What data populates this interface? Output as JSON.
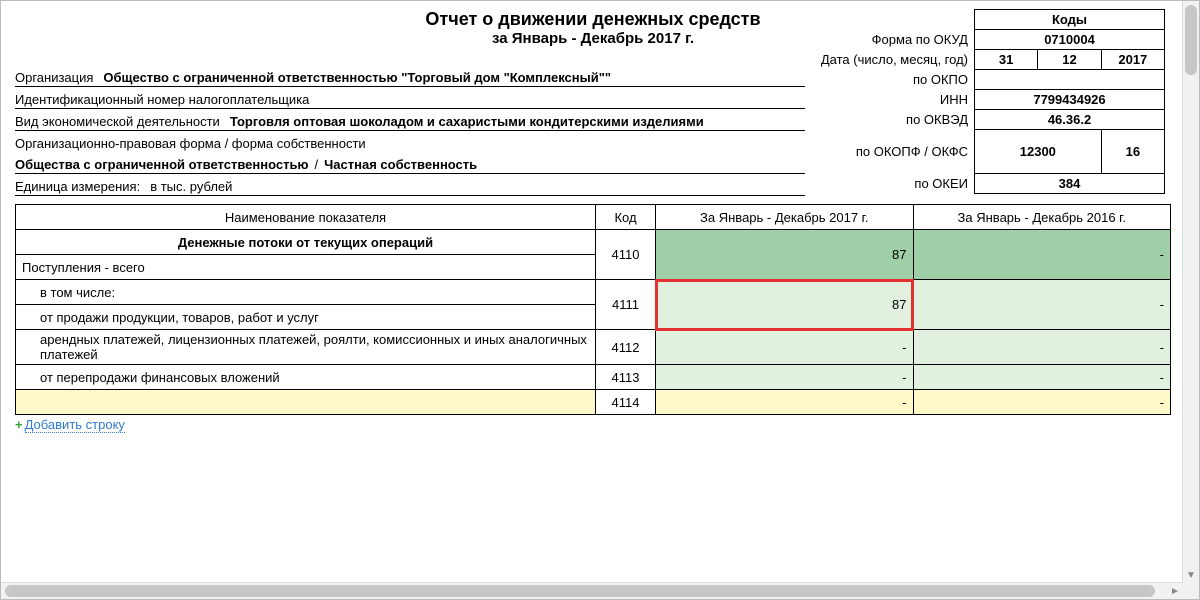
{
  "header": {
    "title": "Отчет о движении денежных средств",
    "period": "за Январь - Декабрь 2017 г."
  },
  "org": {
    "label": "Организация",
    "name": "Общество с ограниченной ответственностью \"Торговый дом \"Комплексный\"\"",
    "inn_label": "Идентификационный номер налогоплательщика",
    "activity_label": "Вид экономической деятельности",
    "activity": "Торговля оптовая шоколадом и сахаристыми кондитерскими изделиями",
    "legal_form_label": "Организационно-правовая форма / форма собственности",
    "legal_form": "Общества с ограниченной ответственностью",
    "ownership": "Частная собственность",
    "unit_label": "Единица измерения:",
    "unit": "в тыс. рублей"
  },
  "codes": {
    "title": "Коды",
    "okud_label": "Форма по ОКУД",
    "okud": "0710004",
    "date_label": "Дата (число, месяц, год)",
    "date_day": "31",
    "date_month": "12",
    "date_year": "2017",
    "okpo_label": "по ОКПО",
    "okpo": "",
    "inn_label": "ИНН",
    "inn": "7799434926",
    "okved_label": "по ОКВЭД",
    "okved": "46.36.2",
    "okopf_label": "по ОКОПФ / ОКФС",
    "okopf": "12300",
    "okfs": "16",
    "okei_label": "по ОКЕИ",
    "okei": "384"
  },
  "table": {
    "col_name": "Наименование показателя",
    "col_code": "Код",
    "col_cur": "За Январь - Декабрь 2017 г.",
    "col_prev": "За Январь - Декабрь 2016 г.",
    "section": "Денежные потоки от текущих операций",
    "rows": [
      {
        "name": "Поступления - всего",
        "code": "4110",
        "cur": "87",
        "prev": "-"
      },
      {
        "name": "в том числе:",
        "code": "",
        "cur": "",
        "prev": ""
      },
      {
        "name": "от продажи продукции, товаров, работ и услуг",
        "code": "4111",
        "cur": "87",
        "prev": "-"
      },
      {
        "name": "арендных платежей, лицензионных платежей, роялти, комиссионных и иных аналогичных платежей",
        "code": "4112",
        "cur": "-",
        "prev": "-"
      },
      {
        "name": "от перепродажи финансовых вложений",
        "code": "4113",
        "cur": "-",
        "prev": "-"
      },
      {
        "name": "",
        "code": "4114",
        "cur": "-",
        "prev": "-"
      }
    ]
  },
  "actions": {
    "add_row": "Добавить строку"
  }
}
